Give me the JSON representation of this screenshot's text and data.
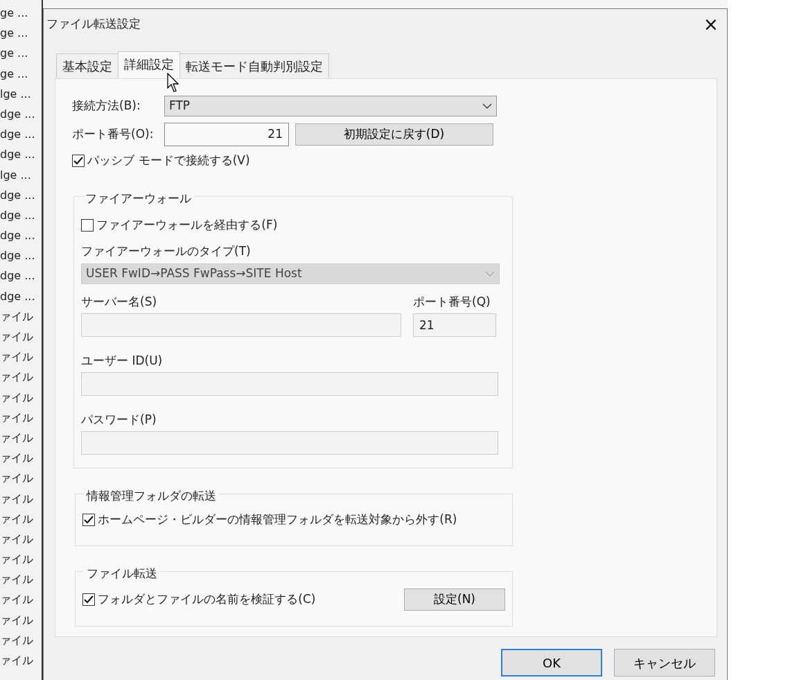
{
  "background_list": {
    "rows": [
      {
        "text": "ge ..."
      },
      {
        "text": "ge ..."
      },
      {
        "text": "ge ..."
      },
      {
        "text": "ge ..."
      },
      {
        "text": "lge ..."
      },
      {
        "text": "dge ..."
      },
      {
        "text": "dge ..."
      },
      {
        "text": "dge ..."
      },
      {
        "text": "lge ..."
      },
      {
        "text": "dge ..."
      },
      {
        "text": "dge ..."
      },
      {
        "text": "dge ..."
      },
      {
        "text": "dge ..."
      },
      {
        "text": "dge ..."
      },
      {
        "text": "dge ..."
      },
      {
        "text": "ァイル"
      },
      {
        "text": "ァイル"
      },
      {
        "text": "ァイル"
      },
      {
        "text": "ァイル"
      },
      {
        "text": "ァイル"
      },
      {
        "text": "ァイル"
      },
      {
        "text": "ァイル"
      },
      {
        "text": "ァイル"
      },
      {
        "text": "ァイル"
      },
      {
        "text": "ァイル"
      },
      {
        "text": "ァイル"
      },
      {
        "text": "ァイル"
      },
      {
        "text": "ァイル"
      },
      {
        "text": "ァイル"
      },
      {
        "text": "ァイル"
      },
      {
        "text": "ァイル"
      },
      {
        "text": "ァイル"
      },
      {
        "text": "ァイル"
      }
    ]
  },
  "window": {
    "title": "ファイル転送設定",
    "close": "×"
  },
  "tabs": [
    {
      "label": "基本設定",
      "selected": false
    },
    {
      "label": "詳細設定",
      "selected": true
    },
    {
      "label": "転送モード自動判別設定",
      "selected": false
    }
  ],
  "connection": {
    "method_label": "接続方法(B):",
    "method_value": "FTP",
    "port_label": "ポート番号(O):",
    "port_value": "21",
    "reset_button": "初期設定に戻す(D)",
    "passive": {
      "label": "パッシブ モードで接続する(V)",
      "checked": true
    }
  },
  "firewall": {
    "title": "ファイアーウォール",
    "use": {
      "label": "ファイアーウォールを経由する(F)",
      "checked": false
    },
    "type_label": "ファイアーウォールのタイプ(T)",
    "type_value": "USER FwID→PASS FwPass→SITE Host",
    "disabled": true,
    "server_label": "サーバー名(S)",
    "port_label": "ポート番号(Q)",
    "port_value": "21",
    "user_label": "ユーザー ID(U)",
    "password_label": "パスワード(P)"
  },
  "info_folder": {
    "title": "情報管理フォルダの転送",
    "exclude": {
      "label": "ホームページ・ビルダーの情報管理フォルダを転送対象から外す(R)",
      "checked": true
    }
  },
  "file_transfer": {
    "title": "ファイル転送",
    "verify": {
      "label": "フォルダとファイルの名前を検証する(C)",
      "checked": true
    },
    "settings_button": "設定(N)"
  },
  "buttons": [
    {
      "label": "OK",
      "default": true
    },
    {
      "label": "キャンセル",
      "default": false
    }
  ]
}
